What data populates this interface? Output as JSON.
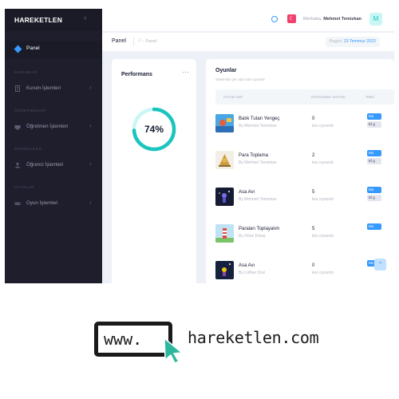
{
  "app": {
    "brand": "HAREKETLEN",
    "collapse_icon": "chevron-left-icon"
  },
  "header": {
    "greeting": "Merhaba,",
    "user_name": "Mehmet Temizkan",
    "avatar_letter": "M",
    "flag_glyph": "☾"
  },
  "subheader": {
    "title": "Panel",
    "breadcrumb": "- Panel",
    "date_label": "Bugün:",
    "date_value": "23 Temmuz 2023"
  },
  "sidebar": {
    "active": {
      "label": "Panel",
      "icon": "diamond-icon"
    },
    "sections": [
      {
        "title": "KURUMLAR",
        "item": "Kurum İşlemleri",
        "icon": "building-icon"
      },
      {
        "title": "ÖĞRETMENLER",
        "item": "Öğretmen İşlemleri",
        "icon": "teacher-icon"
      },
      {
        "title": "ÖĞRENCİLER",
        "item": "Öğrenci İşlemleri",
        "icon": "student-icon"
      },
      {
        "title": "OYUNLAR",
        "item": "Oyun İşlemleri",
        "icon": "gamepad-icon"
      }
    ],
    "arrow": "›"
  },
  "performance": {
    "title": "Performans",
    "menu": "···",
    "value_label": "74%",
    "value": 0.74,
    "track_color": "#c9f7f5",
    "fill_color": "#1bc5bd"
  },
  "games": {
    "title": "Oyunlar",
    "subtitle": "Sistemde yer alan tüm oyunlar",
    "columns": [
      "OYUN ADI",
      "OYNANMA SAYISI",
      "REC"
    ],
    "unit": "kez oynandı",
    "rows": [
      {
        "name": "Balık Tutan Yengeç",
        "author": "By Mehmet Temizkan",
        "count": "0",
        "b1": "Mo",
        "b2": "El g"
      },
      {
        "name": "Para Toplama",
        "author": "By Mehmet Temizkan",
        "count": "2",
        "b1": "Mo",
        "b2": "El g"
      },
      {
        "name": "Asa Avı",
        "author": "By Mehmet Temizkan",
        "count": "5",
        "b1": "Mo",
        "b2": "El g"
      },
      {
        "name": "Paraları Toplayalım",
        "author": "By Döne Erbaş",
        "count": "5",
        "b1": "Mo",
        "b2": ""
      },
      {
        "name": "Asa Avı",
        "author": "By Lütfiye Oral",
        "count": "0",
        "b1": "Mo",
        "b2": ""
      }
    ]
  },
  "footer_banner": {
    "www": "www.",
    "site": "hareketlen.com"
  }
}
